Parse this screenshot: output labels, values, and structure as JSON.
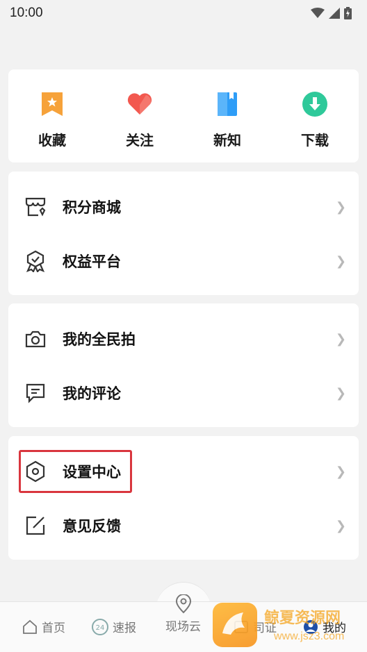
{
  "status_bar": {
    "time": "10:00"
  },
  "quick_actions": [
    {
      "label": "收藏",
      "icon": "bookmark-star-icon",
      "color": "#f6a23a"
    },
    {
      "label": "关注",
      "icon": "heart-icon",
      "color": "#f2584f"
    },
    {
      "label": "新知",
      "icon": "book-icon",
      "color": "#2e9df7"
    },
    {
      "label": "下载",
      "icon": "download-icon",
      "color": "#2fc99a"
    }
  ],
  "menu_groups": [
    {
      "items": [
        {
          "label": "积分商城",
          "icon": "shop-icon"
        },
        {
          "label": "权益平台",
          "icon": "badge-icon"
        }
      ]
    },
    {
      "items": [
        {
          "label": "我的全民拍",
          "icon": "camera-icon"
        },
        {
          "label": "我的评论",
          "icon": "comment-icon"
        }
      ]
    },
    {
      "items": [
        {
          "label": "设置中心",
          "icon": "hexagon-settings-icon",
          "highlighted": true
        },
        {
          "label": "意见反馈",
          "icon": "edit-icon"
        }
      ]
    }
  ],
  "tabbar": {
    "home": "首页",
    "news": "速报",
    "scene": "现场云",
    "license": "司证",
    "mine": "我的"
  },
  "watermark": {
    "text": "鲸夏资源网",
    "url": "www.jsz3.com"
  }
}
